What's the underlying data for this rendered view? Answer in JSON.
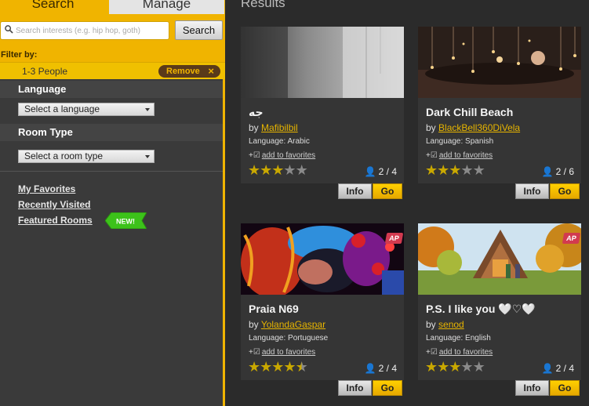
{
  "tabs": {
    "search": "Search",
    "manage": "Manage"
  },
  "search": {
    "placeholder": "Search interests (e.g. hip hop, goth)",
    "button": "Search"
  },
  "filter": {
    "label": "Filter by:",
    "value": "1-3 People",
    "remove": "Remove",
    "remove_icon": "×"
  },
  "language": {
    "heading": "Language",
    "select": "Select a language"
  },
  "room_type": {
    "heading": "Room Type",
    "select": "Select a room type"
  },
  "links": {
    "favorites": "My Favorites",
    "recent": "Recently Visited",
    "featured": "Featured Rooms",
    "new_badge": "NEW!"
  },
  "results_title": "Results",
  "card_labels": {
    "by": "by",
    "add_fav": "add to favorites",
    "plus": "+",
    "info": "Info",
    "go": "Go",
    "ap": "AP"
  },
  "cards": [
    {
      "title": "جه",
      "owner": "Mafibilbil",
      "language": "Language: Arabic",
      "rating": 3,
      "count": "2 / 4",
      "ap": false
    },
    {
      "title": "Dark Chill Beach",
      "owner": "BlackBell360DiVela",
      "language": "Language: Spanish",
      "rating": 3,
      "count": "2 / 6",
      "ap": false
    },
    {
      "title": "Praia N69",
      "owner": "YolandaGaspar",
      "language": "Language: Portuguese",
      "rating": 4.5,
      "count": "2 / 4",
      "ap": true
    },
    {
      "title": "P.S. I like you 🤍♡🤍",
      "owner": "senod",
      "language": "Language: English",
      "rating": 3,
      "count": "2 / 4",
      "ap": true
    }
  ],
  "colors": {
    "accent": "#f0b400",
    "panel": "#3a3a3a",
    "star_on": "#c9a800",
    "star_off": "#8a8a8a",
    "ap_badge": "#d23a4f"
  }
}
